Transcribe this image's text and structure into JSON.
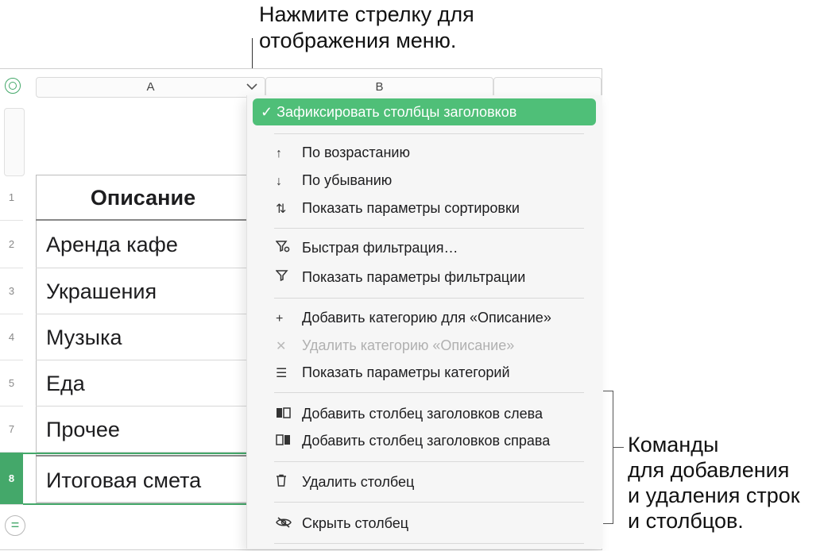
{
  "callouts": {
    "top_line1": "Нажмите стрелку для",
    "top_line2": "отображения меню.",
    "right_line1": "Команды",
    "right_line2": "для добавления",
    "right_line3": "и удаления строк",
    "right_line4": "и столбцов."
  },
  "columns": {
    "a": "A",
    "b": "B"
  },
  "rows": [
    {
      "num": "1",
      "text": "Описание"
    },
    {
      "num": "2",
      "text": "Аренда кафе"
    },
    {
      "num": "3",
      "text": "Украшения"
    },
    {
      "num": "4",
      "text": "Музыка"
    },
    {
      "num": "5",
      "text": "Еда"
    },
    {
      "num": "7",
      "text": "Прочее"
    },
    {
      "num": "8",
      "text": "Итоговая смета"
    }
  ],
  "menu": {
    "freeze": "✓ Зафиксировать столбцы заголовков",
    "sort_asc": "По возрастанию",
    "sort_desc": "По убыванию",
    "sort_opts": "Показать параметры сортировки",
    "quick_filter": "Быстрая фильтрация…",
    "filter_opts": "Показать параметры фильтрации",
    "add_cat": "Добавить категорию для «Описание»",
    "del_cat": "Удалить категорию «Описание»",
    "cat_opts": "Показать параметры категорий",
    "add_hdr_left": "Добавить столбец заголовков слева",
    "add_hdr_right": "Добавить столбец заголовков справа",
    "del_col": "Удалить столбец",
    "hide_col": "Скрыть столбец"
  },
  "icons": {
    "sort_asc": "arrow-up-icon",
    "sort_desc": "arrow-down-icon",
    "sort_opts": "sort-icon",
    "quick_filter": "quick-filter-icon",
    "filter_opts": "filter-icon",
    "add_cat": "plus-icon",
    "del_cat": "x-icon",
    "cat_opts": "list-icon",
    "add_hdr_left": "column-left-icon",
    "add_hdr_right": "column-right-icon",
    "del_col": "trash-icon",
    "hide_col": "eye-slash-icon"
  },
  "colors": {
    "accent": "#4fbf78",
    "selection": "#44a86a"
  }
}
